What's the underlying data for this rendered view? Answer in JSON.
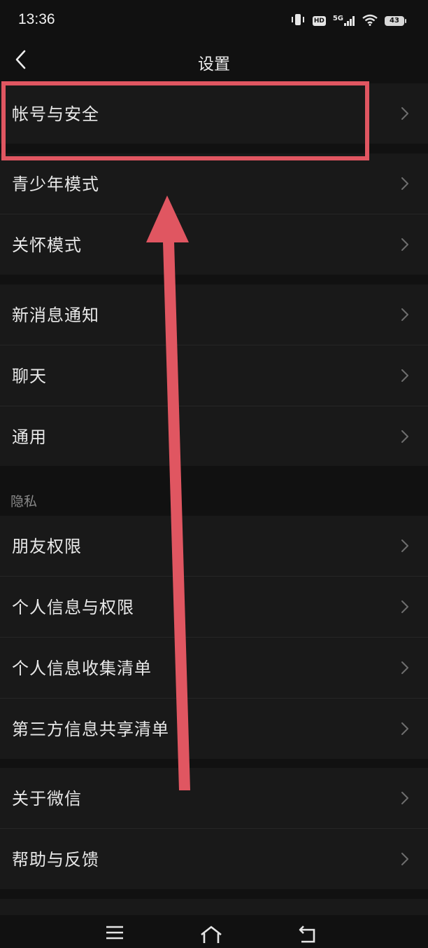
{
  "status_bar": {
    "time": "13:36",
    "network": "5G",
    "hd": "HD",
    "battery": "43",
    "icons": [
      "vibrate-icon",
      "hd-icon",
      "cellular-signal-icon",
      "wifi-icon",
      "battery-icon"
    ]
  },
  "nav": {
    "title": "设置",
    "back_icon": "chevron-left-icon"
  },
  "sections": [
    {
      "items": [
        {
          "label": "帐号与安全"
        }
      ]
    },
    {
      "items": [
        {
          "label": "青少年模式"
        },
        {
          "label": "关怀模式"
        }
      ]
    },
    {
      "items": [
        {
          "label": "新消息通知"
        },
        {
          "label": "聊天"
        },
        {
          "label": "通用"
        }
      ]
    },
    {
      "header": "隐私",
      "items": [
        {
          "label": "朋友权限"
        },
        {
          "label": "个人信息与权限"
        },
        {
          "label": "个人信息收集清单"
        },
        {
          "label": "第三方信息共享清单"
        }
      ]
    },
    {
      "items": [
        {
          "label": "关于微信"
        },
        {
          "label": "帮助与反馈"
        }
      ]
    }
  ],
  "row_chevron_icon": "chevron-right-icon",
  "system_nav": {
    "icons": [
      "menu-icon",
      "home-icon",
      "back-icon"
    ]
  },
  "annotation": {
    "highlight_color": "#e05661",
    "arrow_color": "#e05661"
  },
  "colors": {
    "background": "#111111",
    "row_background": "#191919",
    "text": "#e8e8e8",
    "secondary_text": "#8a8a8a"
  }
}
